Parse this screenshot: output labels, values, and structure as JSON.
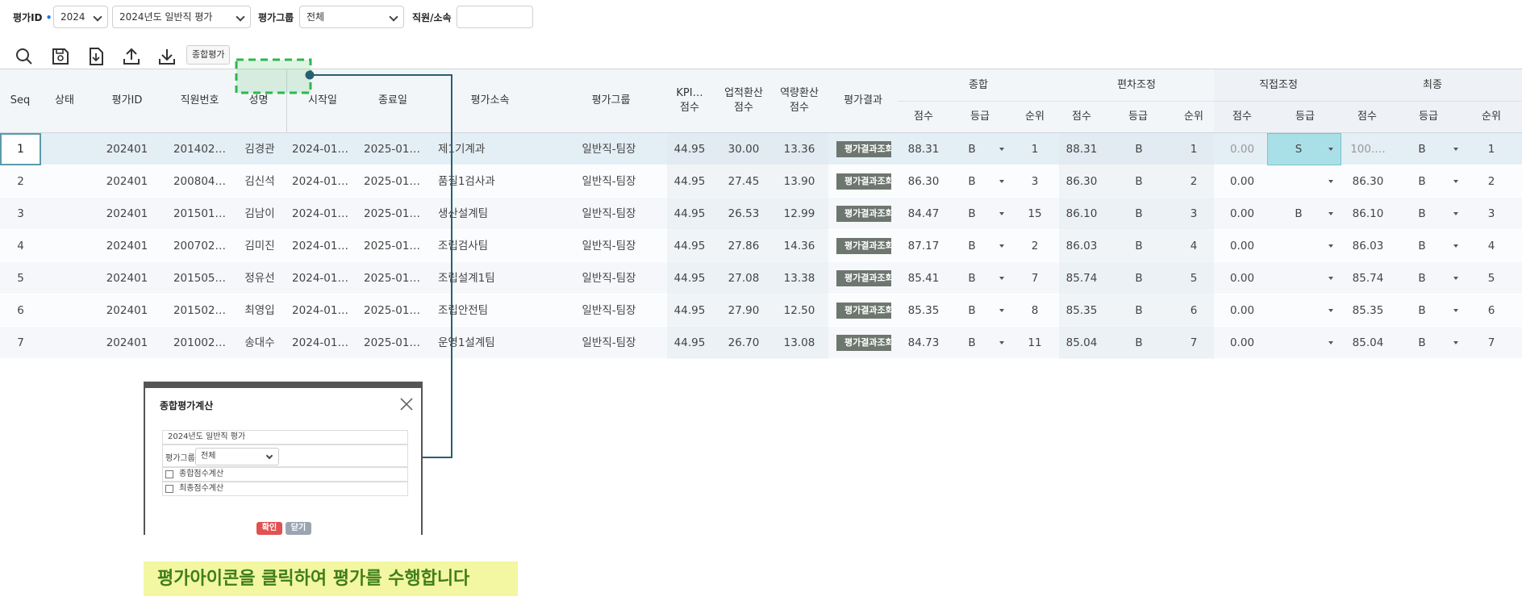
{
  "filter": {
    "eval_id_label": "평가ID",
    "required_mark": "•",
    "year_value": "2024",
    "eval_name_value": "2024년도 일반직 평가",
    "eval_group_label": "평가그룹",
    "eval_group_value": "전체",
    "employee_label": "직원/소속",
    "employee_value": ""
  },
  "toolbar": {
    "overall_eval_label": "종합평가",
    "icons": [
      "search-icon",
      "save-icon",
      "download-file-icon",
      "upload-icon",
      "download-icon"
    ]
  },
  "grid": {
    "headers": {
      "seq": "Seq",
      "status": "상태",
      "eval_id": "평가ID",
      "emp_no": "직원번호",
      "name": "성명",
      "start_date": "시작일",
      "end_date": "종료일",
      "dept": "평가소속",
      "group": "평가그룹",
      "kpi_1": "KPI…",
      "kpi_2": "점수",
      "perf_1": "업적환산",
      "perf_2": "점수",
      "comp_1": "역량환산",
      "comp_2": "점수",
      "result": "평가결과",
      "overall": "종합",
      "deviation": "편차조정",
      "direct": "직접조정",
      "final": "최종",
      "score": "점수",
      "grade": "등급",
      "rank": "순위"
    },
    "result_button_label": "평가결과조회",
    "rows": [
      {
        "seq": "1",
        "eval_id": "202401",
        "emp_no": "201402…",
        "name": "김경관",
        "start": "2024-01…",
        "end": "2025-01…",
        "dept": "제1기계과",
        "group": "일반직-팀장",
        "kpi": "44.95",
        "perf": "30.00",
        "comp": "13.36",
        "t_score": "88.31",
        "t_grade": "B",
        "t_rank": "1",
        "d_score": "88.31",
        "d_grade": "B",
        "d_rank": "1",
        "a_score": "0.00",
        "a_grade": "S",
        "f_score": "100.…",
        "f_grade": "B",
        "f_rank": "1"
      },
      {
        "seq": "2",
        "eval_id": "202401",
        "emp_no": "200804…",
        "name": "김신석",
        "start": "2024-01…",
        "end": "2025-01…",
        "dept": "품질1검사과",
        "group": "일반직-팀장",
        "kpi": "44.95",
        "perf": "27.45",
        "comp": "13.90",
        "t_score": "86.30",
        "t_grade": "B",
        "t_rank": "3",
        "d_score": "86.30",
        "d_grade": "B",
        "d_rank": "2",
        "a_score": "0.00",
        "a_grade": "",
        "f_score": "86.30",
        "f_grade": "B",
        "f_rank": "2"
      },
      {
        "seq": "3",
        "eval_id": "202401",
        "emp_no": "201501…",
        "name": "김남이",
        "start": "2024-01…",
        "end": "2025-01…",
        "dept": "생산설계팀",
        "group": "일반직-팀장",
        "kpi": "44.95",
        "perf": "26.53",
        "comp": "12.99",
        "t_score": "84.47",
        "t_grade": "B",
        "t_rank": "15",
        "d_score": "86.10",
        "d_grade": "B",
        "d_rank": "3",
        "a_score": "0.00",
        "a_grade": "B",
        "f_score": "86.10",
        "f_grade": "B",
        "f_rank": "3"
      },
      {
        "seq": "4",
        "eval_id": "202401",
        "emp_no": "200702…",
        "name": "김미진",
        "start": "2024-01…",
        "end": "2025-01…",
        "dept": "조립검사팀",
        "group": "일반직-팀장",
        "kpi": "44.95",
        "perf": "27.86",
        "comp": "14.36",
        "t_score": "87.17",
        "t_grade": "B",
        "t_rank": "2",
        "d_score": "86.03",
        "d_grade": "B",
        "d_rank": "4",
        "a_score": "0.00",
        "a_grade": "",
        "f_score": "86.03",
        "f_grade": "B",
        "f_rank": "4"
      },
      {
        "seq": "5",
        "eval_id": "202401",
        "emp_no": "201505…",
        "name": "정유선",
        "start": "2024-01…",
        "end": "2025-01…",
        "dept": "조립설계1팀",
        "group": "일반직-팀장",
        "kpi": "44.95",
        "perf": "27.08",
        "comp": "13.38",
        "t_score": "85.41",
        "t_grade": "B",
        "t_rank": "7",
        "d_score": "85.74",
        "d_grade": "B",
        "d_rank": "5",
        "a_score": "0.00",
        "a_grade": "",
        "f_score": "85.74",
        "f_grade": "B",
        "f_rank": "5"
      },
      {
        "seq": "6",
        "eval_id": "202401",
        "emp_no": "201502…",
        "name": "최영입",
        "start": "2024-01…",
        "end": "2025-01…",
        "dept": "조립안전팀",
        "group": "일반직-팀장",
        "kpi": "44.95",
        "perf": "27.90",
        "comp": "12.50",
        "t_score": "85.35",
        "t_grade": "B",
        "t_rank": "8",
        "d_score": "85.35",
        "d_grade": "B",
        "d_rank": "6",
        "a_score": "0.00",
        "a_grade": "",
        "f_score": "85.35",
        "f_grade": "B",
        "f_rank": "6"
      },
      {
        "seq": "7",
        "eval_id": "202401",
        "emp_no": "201002…",
        "name": "송대수",
        "start": "2024-01…",
        "end": "2025-01…",
        "dept": "운영1설계팀",
        "group": "일반직-팀장",
        "kpi": "44.95",
        "perf": "26.70",
        "comp": "13.08",
        "t_score": "84.73",
        "t_grade": "B",
        "t_rank": "11",
        "d_score": "85.04",
        "d_grade": "B",
        "d_rank": "7",
        "a_score": "0.00",
        "a_grade": "",
        "f_score": "85.04",
        "f_grade": "B",
        "f_rank": "7"
      }
    ]
  },
  "popup": {
    "title": "종합평가계산",
    "eval_name": "2024년도 일반직 평가",
    "group_label": "평가그룹",
    "group_value": "전체",
    "check_overall": "종합점수계산",
    "check_final": "최종점수계산",
    "confirm_label": "확인",
    "close_label": "닫기"
  },
  "note": {
    "text": "평가아이콘을 클릭하여 평가를 수행합니다"
  },
  "colors": {
    "highlight_cell": "#a9e0e8",
    "row_selected": "#e4eef5",
    "callout_line": "#2a5f72",
    "callout_box": "#2db84d",
    "note_bg": "#f4f7a1",
    "note_text": "#3f7e1c",
    "confirm_button": "#e05252",
    "close_button": "#9aa5b1"
  }
}
